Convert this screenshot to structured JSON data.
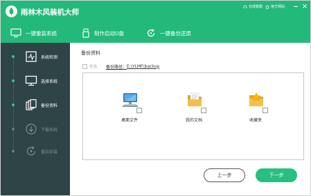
{
  "app": {
    "title": "雨林木风装机大师"
  },
  "titlebar": {
    "online_service": "在线客服",
    "official_site": "官方网站"
  },
  "nav": {
    "tabs": [
      {
        "label": "一键重装系统"
      },
      {
        "label": "制作启动U盘"
      },
      {
        "label": "一键备份还原"
      }
    ]
  },
  "sidebar": {
    "steps": [
      {
        "label": "系统检测",
        "state": "done",
        "icon": "pulse-monitor-icon"
      },
      {
        "label": "选择系统",
        "state": "done",
        "icon": "monitor-icon"
      },
      {
        "label": "备份资料",
        "state": "current",
        "icon": "copy-files-icon"
      },
      {
        "label": "下载系统",
        "state": "pending",
        "icon": "download-icon"
      },
      {
        "label": "重启安装",
        "state": "pending",
        "icon": "restart-icon"
      }
    ]
  },
  "main": {
    "section_title": "备份资料",
    "select_all_label": "全选",
    "backup_path_label": "备份路径：",
    "backup_path_value": "E:\\YLMF\\backup",
    "files": [
      {
        "name": "桌面文件",
        "icon": "desktop-computer-icon",
        "checked": false
      },
      {
        "name": "我的文档",
        "icon": "documents-folder-icon",
        "checked": false
      },
      {
        "name": "收藏夹",
        "icon": "favorites-folder-icon",
        "checked": false
      }
    ],
    "prev_button": "上一步",
    "next_button": "下一步"
  },
  "colors": {
    "accent": "#23b97b",
    "sidebar": "#2f4447",
    "step_done": "#2ecc85"
  }
}
